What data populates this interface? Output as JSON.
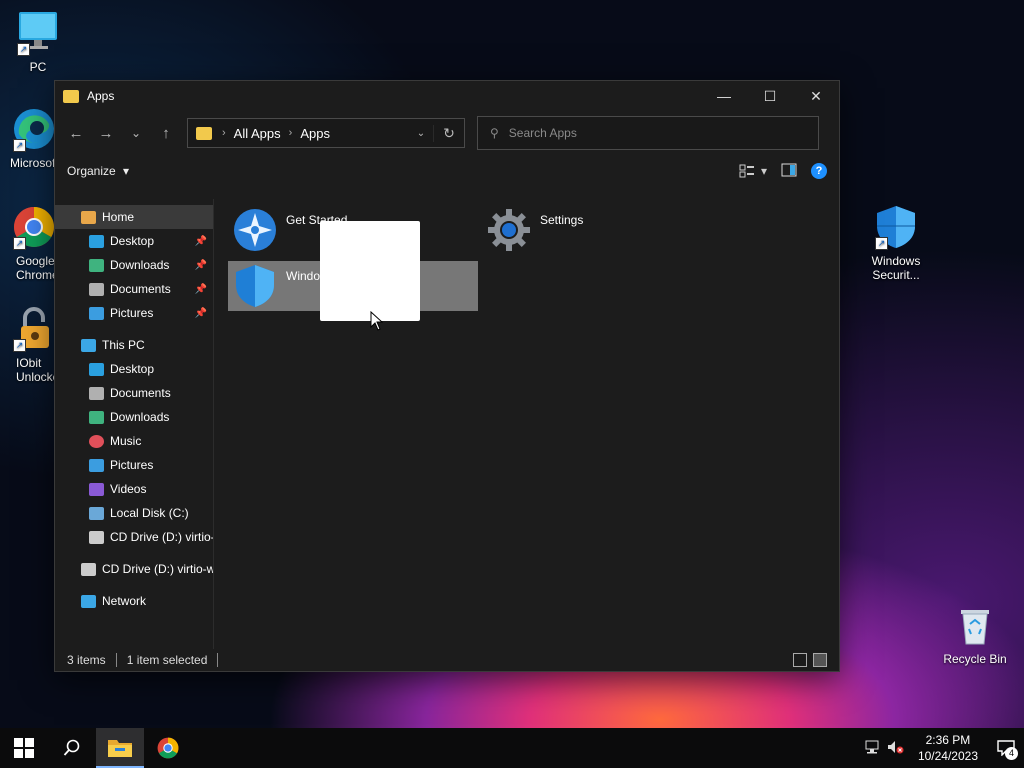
{
  "desktop": {
    "icons": [
      {
        "label": "PC"
      },
      {
        "label": "Microsoft Edge"
      },
      {
        "label": "Google Chrome"
      },
      {
        "label": "IObit Unlocker"
      },
      {
        "label": "Windows Securit..."
      },
      {
        "label": "Recycle Bin"
      }
    ]
  },
  "window": {
    "title": "Apps",
    "controls": {
      "minimize": "—",
      "maximize": "☐",
      "close": "✕"
    },
    "nav": {
      "back": "←",
      "forward": "→",
      "recent": "⌄",
      "up": "↑"
    },
    "address": {
      "crumbs": [
        "All Apps",
        "Apps"
      ],
      "separator": "›",
      "dropdown": "⌄",
      "refresh": "↻"
    },
    "search": {
      "placeholder": "Search Apps",
      "value": "",
      "icon": "⚲"
    },
    "command_bar": {
      "organize": "Organize",
      "organize_caret": "▾",
      "view_caret": "▾",
      "help": "?"
    },
    "nav_pane": {
      "quick_access": [
        {
          "label": "Home",
          "icon": "home-icon",
          "color": "#e8a74a"
        },
        {
          "label": "Desktop",
          "icon": "desktop-icon",
          "color": "#2aa0e0",
          "pinned": true
        },
        {
          "label": "Downloads",
          "icon": "downloads-icon",
          "color": "#3fb37f",
          "pinned": true
        },
        {
          "label": "Documents",
          "icon": "documents-icon",
          "color": "#b0b0b0",
          "pinned": true
        },
        {
          "label": "Pictures",
          "icon": "pictures-icon",
          "color": "#3b9de0",
          "pinned": true
        }
      ],
      "this_pc": {
        "label": "This PC",
        "color": "#3ba7e6"
      },
      "this_pc_items": [
        {
          "label": "Desktop",
          "icon": "desktop-icon",
          "color": "#2aa0e0"
        },
        {
          "label": "Documents",
          "icon": "documents-icon",
          "color": "#b0b0b0"
        },
        {
          "label": "Downloads",
          "icon": "downloads-icon",
          "color": "#3fb37f"
        },
        {
          "label": "Music",
          "icon": "music-icon",
          "color": "#e0505a"
        },
        {
          "label": "Pictures",
          "icon": "pictures-icon",
          "color": "#3b9de0"
        },
        {
          "label": "Videos",
          "icon": "videos-icon",
          "color": "#8a5ad6"
        },
        {
          "label": "Local Disk (C:)",
          "icon": "drive-icon",
          "color": "#6aa8d8"
        },
        {
          "label": "CD Drive (D:) virtio-",
          "icon": "cd-drive-icon",
          "color": "#cccccc"
        }
      ],
      "cd_drive": {
        "label": "CD Drive (D:) virtio-w",
        "color": "#cccccc"
      },
      "network": {
        "label": "Network",
        "color": "#3ba7e6"
      },
      "pin_glyph": "📌"
    },
    "items": [
      {
        "label": "Get Started",
        "icon": "get-started-icon"
      },
      {
        "label": "Settings",
        "icon": "settings-icon"
      },
      {
        "label": "Windows Security",
        "short": "Windo",
        "icon": "windows-security-icon",
        "selected": true
      }
    ],
    "status": {
      "count": "3 items",
      "selection": "1 item selected"
    }
  },
  "taskbar": {
    "clock_time": "2:36 PM",
    "clock_date": "10/24/2023",
    "notifications": "4"
  },
  "colors": {
    "accent": "#1e90ff",
    "folder": "#f2c94c",
    "selected_tile": "#777777"
  }
}
